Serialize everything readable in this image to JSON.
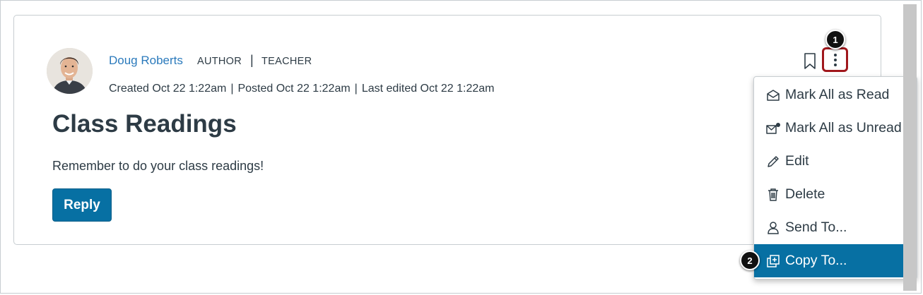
{
  "post": {
    "author_name": "Doug Roberts",
    "role_author": "AUTHOR",
    "role_separator": "|",
    "role_teacher": "TEACHER",
    "created": "Created Oct 22 1:22am",
    "posted": "Posted Oct 22 1:22am",
    "edited": "Last edited Oct 22 1:22am",
    "meta_separator": "|",
    "title": "Class Readings",
    "message": "Remember to do your class readings!",
    "reply_label": "Reply"
  },
  "callouts": {
    "first": "1",
    "second": "2"
  },
  "menu": {
    "items": [
      {
        "label": "Mark All as Read",
        "icon": "envelope-open-icon"
      },
      {
        "label": "Mark All as Unread",
        "icon": "envelope-unread-icon"
      },
      {
        "label": "Edit",
        "icon": "pencil-icon"
      },
      {
        "label": "Delete",
        "icon": "trash-icon"
      },
      {
        "label": "Send To...",
        "icon": "user-send-icon"
      },
      {
        "label": "Copy To...",
        "icon": "copy-icon",
        "active": true
      }
    ]
  },
  "colors": {
    "link": "#2b7abc",
    "primary": "#0770a3",
    "text": "#2d3b45",
    "highlight_border": "#a0171c"
  }
}
